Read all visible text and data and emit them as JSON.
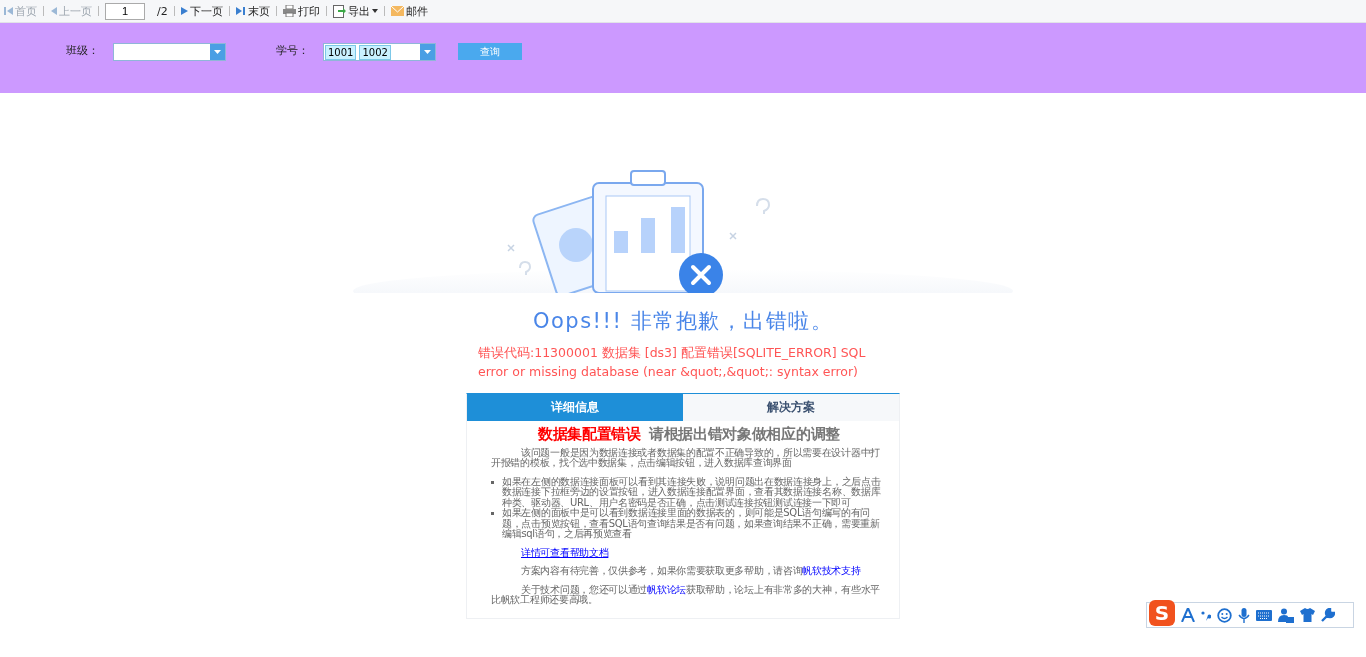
{
  "toolbar": {
    "items": [
      {
        "kind": "first",
        "label": "首页",
        "disabled": true
      },
      {
        "kind": "prev",
        "label": "上一页",
        "disabled": true
      },
      {
        "kind": "page",
        "value": "1"
      },
      {
        "kind": "total",
        "label": "/2"
      },
      {
        "kind": "next",
        "label": "下一页",
        "disabled": false
      },
      {
        "kind": "last",
        "label": "末页",
        "disabled": false
      },
      {
        "kind": "print",
        "label": "打印",
        "disabled": false
      },
      {
        "kind": "export",
        "label": "导出",
        "disabled": false
      },
      {
        "kind": "mail",
        "label": "邮件",
        "disabled": false
      }
    ]
  },
  "filters": {
    "class_label": "班级：",
    "id_label": "学号：",
    "id_tags": [
      "1001",
      "1002"
    ],
    "query_button": "查询"
  },
  "error": {
    "title": "Oops!!! 非常抱歉，出错啦。",
    "message": "错误代码:11300001 数据集 [ds3] 配置错误[SQLITE_ERROR] SQL error or missing database (near &quot;,&quot;: syntax error)",
    "tabs": [
      {
        "label": "详细信息",
        "selected": true
      },
      {
        "label": "解决方案",
        "selected": false
      }
    ],
    "heading": {
      "main": "数据集配置错误",
      "sub": "请根据出错对象做相应的调整"
    },
    "intro": "该问题一般是因为数据连接或者数据集的配置不正确导致的，所以需要在设计器中打开报错的模板，找个选中数据集，点击编辑按钮，进入数据库查询界面",
    "bullets": [
      "如果在左侧的数据连接面板可以看到其连接失败，说明问题出在数据连接身上，之后点击数据连接下拉框旁边的设置按钮，进入数据连接配置界面，查看其数据连接名称、数据库种类、驱动器、URL、用户名密码是否正确，点击测试连接按钮测试连接一下即可",
      "如果左侧的面板中是可以看到数据连接里面的数据表的，则可能是SQL语句编写的有问题，点击预览按钮，查看SQL语句查询结果是否有问题，如果查询结果不正确，需要重新编辑sql语句，之后再预览查看"
    ],
    "help_link": "详情可查看帮助文档",
    "support": {
      "text": "方案内容有待完善，仅供参考，如果你需要获取更多帮助，请咨询",
      "link": "帆软技术支持"
    },
    "forum": {
      "before": "关于技术问题，您还可以通过",
      "link": "帆软论坛",
      "after": "获取帮助，论坛上有非常多的大神，有些水平比帆软工程师还要高哦。"
    }
  },
  "ime": {
    "logo": "S"
  }
}
